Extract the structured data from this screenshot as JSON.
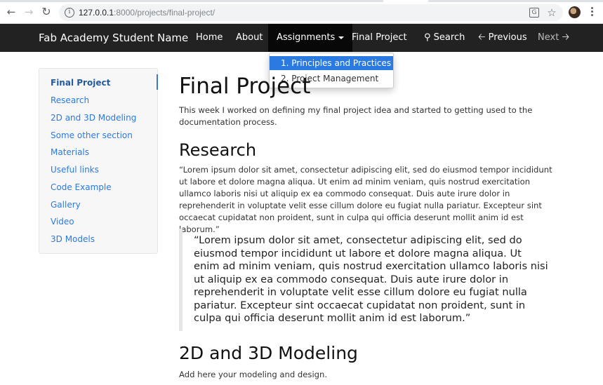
{
  "browser": {
    "url_host": "127.0.0.1",
    "url_rest": ":8000/projects/final-project/",
    "back_icon": "arrow-left-icon",
    "forward_icon": "arrow-right-icon",
    "reload_icon": "reload-icon",
    "info_icon": "info-icon",
    "translate_icon": "translate-icon",
    "star_icon": "star-icon",
    "menu_icon": "kebab-menu-icon"
  },
  "navbar": {
    "brand": "Fab Academy Student Name",
    "items": [
      {
        "label": "Home"
      },
      {
        "label": "About"
      },
      {
        "label": "Assignments"
      },
      {
        "label": "Final Project"
      },
      {
        "label": "Search"
      },
      {
        "label": "Previous"
      },
      {
        "label": "Next"
      }
    ]
  },
  "dropdown": {
    "items": [
      {
        "label": "1. Principles and Practices"
      },
      {
        "label": "2. Project Management"
      }
    ]
  },
  "sidebar": {
    "items": [
      {
        "label": "Final Project"
      },
      {
        "label": "Research"
      },
      {
        "label": "2D and 3D Modeling"
      },
      {
        "label": "Some other section"
      },
      {
        "label": "Materials"
      },
      {
        "label": "Useful links"
      },
      {
        "label": "Code Example"
      },
      {
        "label": "Gallery"
      },
      {
        "label": "Video"
      },
      {
        "label": "3D Models"
      }
    ]
  },
  "content": {
    "title": "Final Project",
    "intro": "This week I worked on defining my final project idea and started to getting used to the documentation process.",
    "research_heading": "Research",
    "research_text": "“Lorem ipsum dolor sit amet, consectetur adipiscing elit, sed do eiusmod tempor incididunt ut labore et dolore magna aliqua. Ut enim ad minim veniam, quis nostrud exercitation ullamco laboris nisi ut aliquip ex ea commodo consequat. Duis aute irure dolor in reprehenderit in voluptate velit esse cillum dolore eu fugiat nulla pariatur. Excepteur sint occaecat cupidatat non proident, sunt in culpa qui officia deserunt mollit anim id est laborum.”",
    "blockquote": "“Lorem ipsum dolor sit amet, consectetur adipiscing elit, sed do eiusmod tempor incididunt ut labore et dolore magna aliqua. Ut enim ad minim veniam, quis nostrud exercitation ullamco laboris nisi ut aliquip ex ea commodo consequat. Duis aute irure dolor in reprehenderit in voluptate velit esse cillum dolore eu fugiat nulla pariatur. Excepteur sint occaecat cupidatat non proident, sunt in culpa qui officia deserunt mollit anim id est laborum.”",
    "modeling_heading": "2D and 3D Modeling",
    "modeling_text": "Add here your modeling and design."
  },
  "colors": {
    "navbar_bg": "#222222",
    "link": "#2a7ae2",
    "dropdown_highlight": "#2a7ae2"
  }
}
